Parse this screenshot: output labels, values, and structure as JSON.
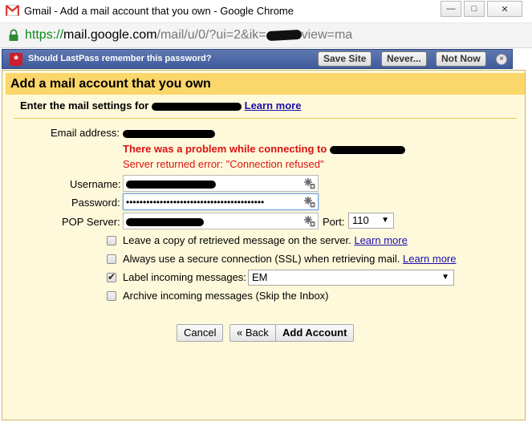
{
  "window": {
    "title": "Gmail - Add a mail account that you own - Google Chrome",
    "controls": [
      "—",
      "□",
      "✕"
    ]
  },
  "address": {
    "scheme": "https://",
    "host": "mail.google.com",
    "path": "/mail/u/0/?ui=2&ik=",
    "path_end": "view=ma"
  },
  "lastpass": {
    "prompt": "Should LastPass remember this password?",
    "save": "Save Site",
    "never": "Never...",
    "not_now": "Not Now",
    "close": "×"
  },
  "dialog": {
    "title": "Add a mail account that you own",
    "subtitle": "Enter the mail settings for",
    "learn_more": "Learn more",
    "email_label": "Email address:",
    "error_title": "There was a problem while connecting to",
    "error_detail": "Server returned error: \"Connection refused\"",
    "username_label": "Username:",
    "password_label": "Password:",
    "password_value": "•••••••••••••••••••••••••••••••••••••••••",
    "pop_label": "POP Server:",
    "port_label": "Port:",
    "port_value": "110",
    "options": [
      {
        "label": "Leave a copy of retrieved message on the server.",
        "link": "Learn more",
        "checked": false
      },
      {
        "label": "Always use a secure connection (SSL) when retrieving mail.",
        "link": "Learn more",
        "checked": false
      },
      {
        "label": "Label incoming messages:",
        "link": "",
        "checked": true
      },
      {
        "label": "Archive incoming messages (Skip the Inbox)",
        "link": "",
        "checked": false
      }
    ],
    "label_select_value": "EM",
    "cancel": "Cancel",
    "back": "« Back",
    "add": "Add Account"
  },
  "colors": {
    "header": "#fbd66b",
    "body": "#fef9db",
    "error": "#dd1111",
    "link": "#1a0dab",
    "lastpass_bar": "#4d67a6"
  }
}
